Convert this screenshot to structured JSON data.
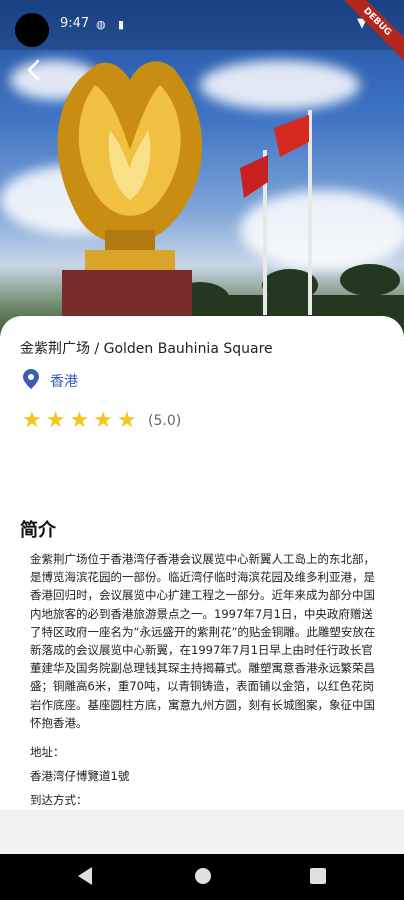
{
  "status_bar": {
    "time": "9:47",
    "debug_badge": "DEBUG"
  },
  "place": {
    "title": "金紫荆广场 / Golden Bauhinia Square",
    "location": "香港",
    "rating_stars": 5,
    "rating_text": "(5.0)"
  },
  "intro": {
    "heading": "简介",
    "description": "金紫荆广场位于香港湾仔香港会议展览中心新翼人工岛上的东北部，是博览海滨花园的一部份。临近湾仔临时海滨花园及维多利亚港，是香港回归时，会议展览中心扩建工程之一部分。近年来成为部分中国内地旅客的必到香港旅游景点之一。1997年7月1日，中央政府赠送了特区政府一座名为“永远盛开的紫荆花”的贴金铜雕。此雕塑安放在新落成的会议展览中心新翼，在1997年7月1日早上由时任行政长官董建华及国务院副总理钱其琛主持揭幕式。雕塑寓意香港永远繁荣昌盛；铜雕高6米，重70吨，以青铜铸造，表面铺以金箔，以红色花岗岩作底座。基座圆柱方底，寓意九州方圆，刻有长城图案，象征中国怀抱香港。",
    "address_label": "地址：",
    "address": "香港湾仔博覽道1號",
    "transport_label": "到达方式："
  },
  "colors": {
    "accent": "#3b5bb5",
    "star": "#f5c518"
  }
}
